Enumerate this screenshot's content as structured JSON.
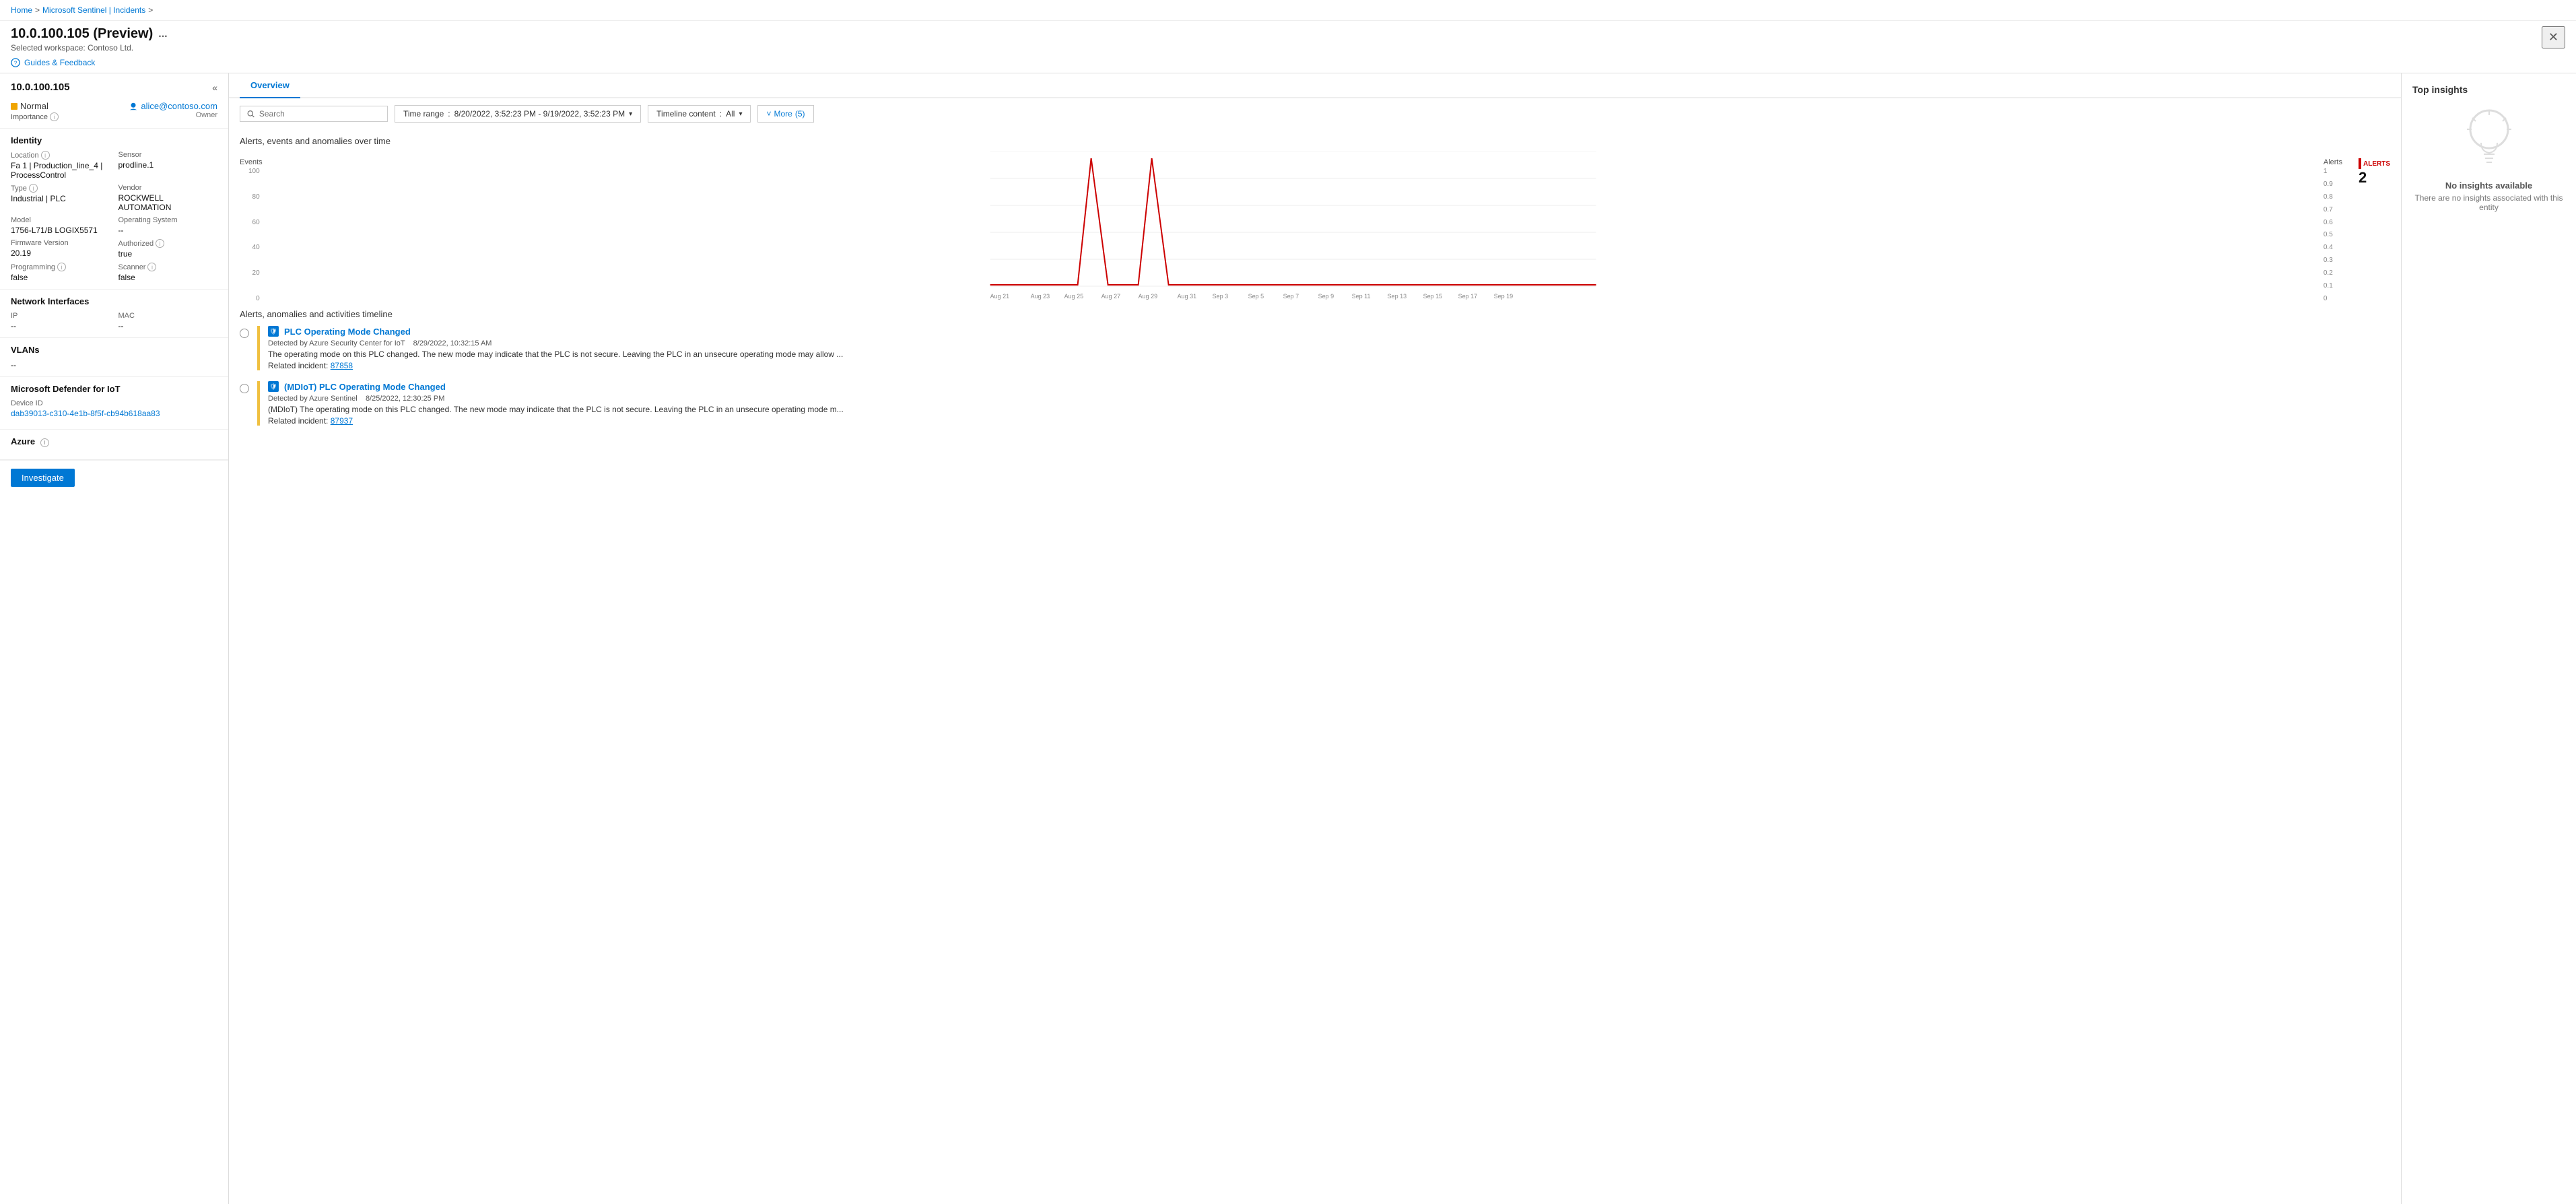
{
  "breadcrumb": {
    "items": [
      "Home",
      "Microsoft Sentinel | Incidents"
    ],
    "separators": [
      ">",
      ">"
    ]
  },
  "header": {
    "title": "10.0.100.105 (Preview)",
    "ellipsis": "...",
    "workspace": "Selected workspace: Contoso Ltd.",
    "close_label": "✕"
  },
  "guides": {
    "label": "Guides & Feedback"
  },
  "left_panel": {
    "entity_name": "10.0.100.105",
    "collapse_icon": "«",
    "status": {
      "importance": "Normal",
      "importance_label": "Importance",
      "owner": "alice@contoso.com",
      "owner_role": "Owner"
    },
    "identity": {
      "title": "Identity",
      "location_label": "Location",
      "location_value": "Fa 1 | Production_line_4 | ProcessControl",
      "sensor_label": "Sensor",
      "sensor_value": "prodline.1",
      "type_label": "Type",
      "type_value": "Industrial | PLC",
      "vendor_label": "Vendor",
      "vendor_value": "ROCKWELL AUTOMATION",
      "model_label": "Model",
      "model_value": "1756-L71/B LOGIX5571",
      "os_label": "Operating System",
      "os_value": "--",
      "firmware_label": "Firmware Version",
      "firmware_value": "20.19",
      "authorized_label": "Authorized",
      "authorized_value": "true",
      "programming_label": "Programming",
      "programming_value": "false",
      "scanner_label": "Scanner",
      "scanner_value": "false"
    },
    "network_interfaces": {
      "title": "Network Interfaces",
      "ip_label": "IP",
      "ip_value": "--",
      "mac_label": "MAC",
      "mac_value": "--"
    },
    "vlans": {
      "title": "VLANs",
      "value": "--"
    },
    "defender": {
      "title": "Microsoft Defender for IoT",
      "device_id_label": "Device ID",
      "device_id_value": "dab39013-c310-4e1b-8f5f-cb94b618aa83"
    },
    "azure": {
      "title": "Azure"
    },
    "investigate_btn": "Investigate"
  },
  "main_panel": {
    "tabs": [
      {
        "label": "Overview",
        "active": true
      }
    ],
    "toolbar": {
      "search_placeholder": "Search",
      "time_range_label": "Time range",
      "time_range_value": "8/20/2022, 3:52:23 PM - 9/19/2022, 3:52:23 PM",
      "timeline_content_label": "Timeline content",
      "timeline_content_value": "All",
      "more_label": "More",
      "more_count": "(5)"
    },
    "chart": {
      "title": "Alerts, events and anomalies over time",
      "events_label": "Events",
      "alerts_label": "Alerts",
      "alerts_count_label": "ALERTS",
      "alerts_count": "2",
      "x_labels": [
        "Aug 21",
        "Aug 23",
        "Aug 25",
        "Aug 27",
        "Aug 29",
        "Aug 31",
        "Sep 3",
        "Sep 5",
        "Sep 7",
        "Sep 9",
        "Sep 11",
        "Sep 13",
        "Sep 15",
        "Sep 17",
        "Sep 19"
      ],
      "y_left_labels": [
        "100",
        "80",
        "60",
        "40",
        "20",
        "0"
      ],
      "y_right_labels": [
        "1",
        "0.9",
        "0.8",
        "0.7",
        "0.6",
        "0.5",
        "0.4",
        "0.3",
        "0.2",
        "0.1",
        "0"
      ]
    },
    "timeline": {
      "title": "Alerts, anomalies and activities timeline",
      "items": [
        {
          "title": "PLC Operating Mode Changed",
          "detected_by": "Detected by Azure Security Center for IoT",
          "date": "8/29/2022, 10:32:15 AM",
          "description": "The operating mode on this PLC changed. The new mode may indicate that the PLC is not secure. Leaving the PLC in an unsecure operating mode may allow ...",
          "related_label": "Related incident:",
          "related_incident": "87858"
        },
        {
          "title": "(MDIoT) PLC Operating Mode Changed",
          "detected_by": "Detected by Azure Sentinel",
          "date": "8/25/2022, 12:30:25 PM",
          "description": "(MDIoT) The operating mode on this PLC changed. The new mode may indicate that the PLC is not secure. Leaving the PLC in an unsecure operating mode m...",
          "related_label": "Related incident:",
          "related_incident": "87937"
        }
      ]
    }
  },
  "insights_panel": {
    "title": "Top insights",
    "no_insights_title": "No insights available",
    "no_insights_desc": "There are no insights associated with this entity"
  }
}
